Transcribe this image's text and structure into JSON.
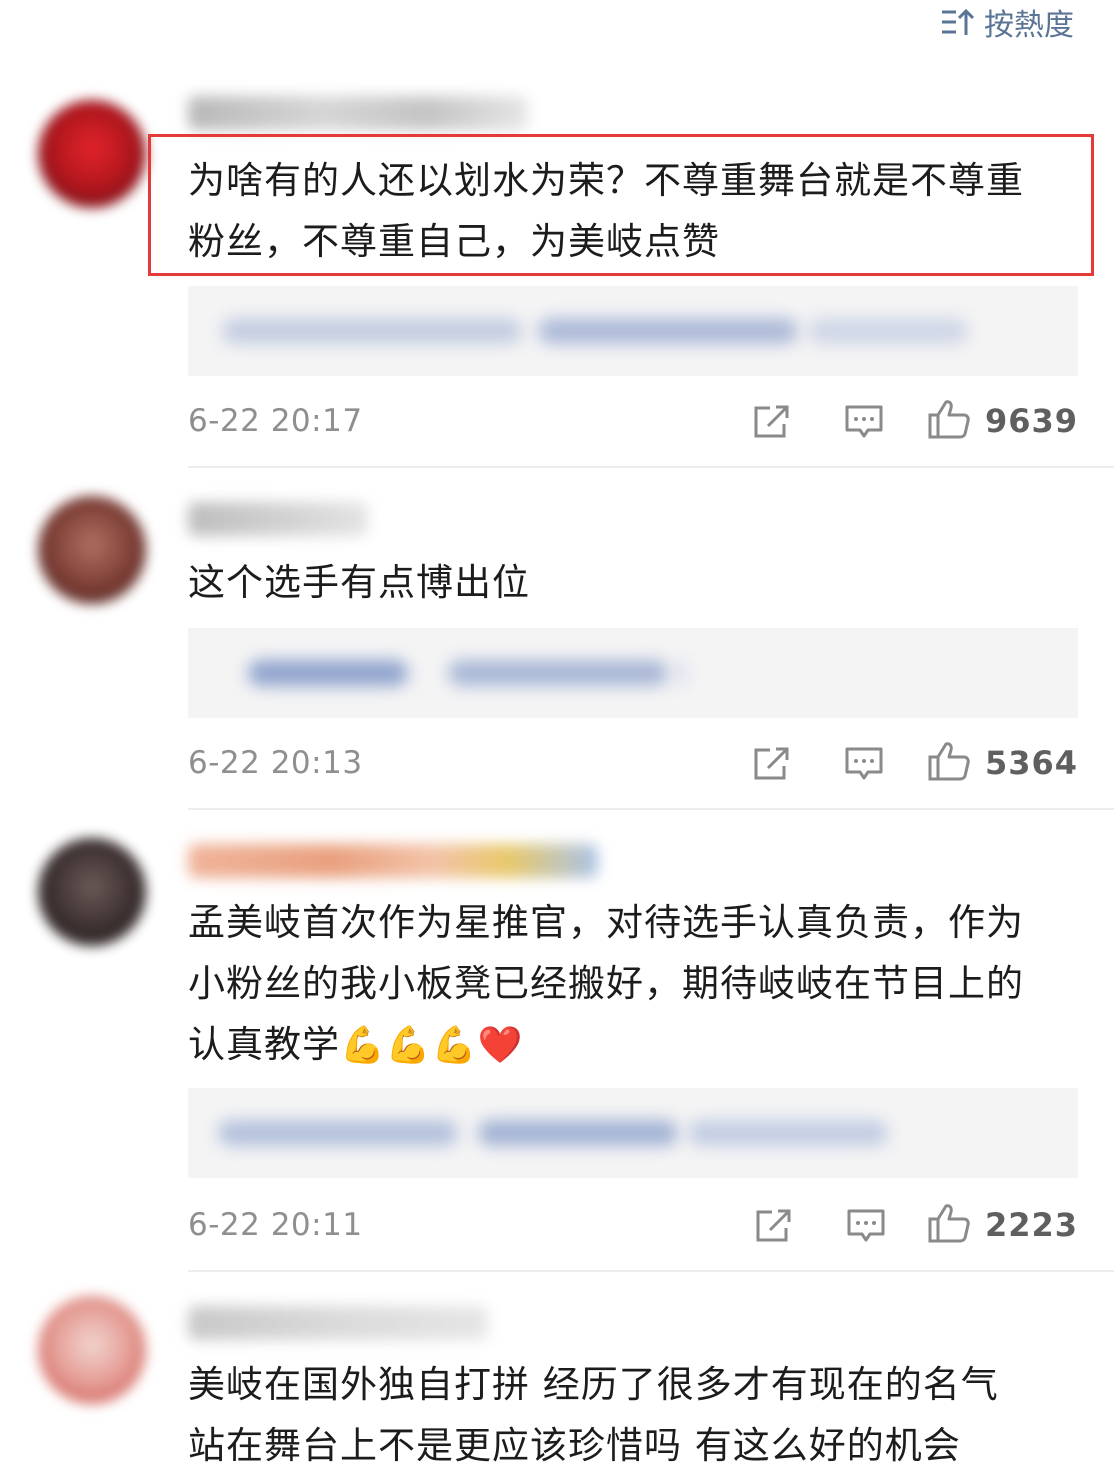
{
  "sort": {
    "label": "按熱度",
    "icon": "sort-icon"
  },
  "colors": {
    "highlight": "#e43a3a",
    "link": "#5a7496",
    "meta": "#8f8f8f"
  },
  "comments": [
    {
      "text_lines": [
        "为啥有的人还以划水为荣？不尊重舞台就是不尊重",
        "粉丝，不尊重自己，为美岐点赞"
      ],
      "time": "6-22 20:17",
      "likes": "9639",
      "highlighted": true
    },
    {
      "text_lines": [
        "这个选手有点博出位"
      ],
      "time": "6-22 20:13",
      "likes": "5364",
      "highlighted": false
    },
    {
      "text_lines": [
        "孟美岐首次作为星推官，对待选手认真负责，作为",
        "小粉丝的我小板凳已经搬好，期待岐岐在节目上的",
        "认真教学"
      ],
      "emojis": "💪💪💪❤️",
      "time": "6-22 20:11",
      "likes": "2223",
      "highlighted": false
    },
    {
      "text_lines": [
        "美岐在国外独自打拼 经历了很多才有现在的名气",
        "站在舞台上不是更应该珍惜吗 有这么好的机会"
      ]
    }
  ]
}
